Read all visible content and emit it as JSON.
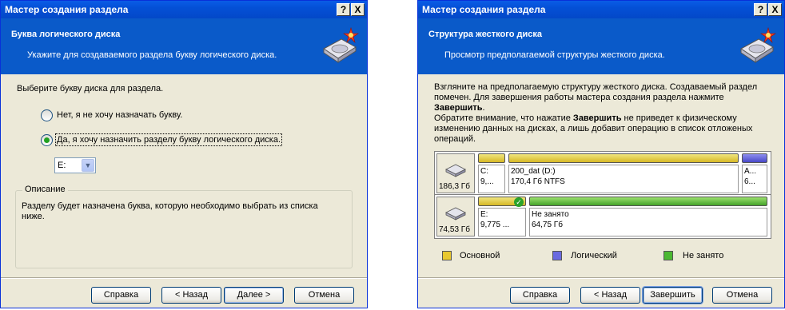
{
  "dialog_left": {
    "title": "Мастер создания раздела",
    "title_buttons": {
      "help": "?",
      "close": "X"
    },
    "header": {
      "title": "Буква логического диска",
      "subtitle": "Укажите для создаваемого раздела букву логического диска."
    },
    "prompt": "Выберите букву диска для раздела.",
    "options": [
      {
        "label": "Нет, я не хочу назначать букву.",
        "selected": false
      },
      {
        "label": "Да, я хочу назначить разделу букву логического диска.",
        "selected": true
      }
    ],
    "drive_letter": {
      "value": "E:"
    },
    "description": {
      "legend": "Описание",
      "text": "Разделу будет назначена буква, которую необходимо выбрать из списка ниже."
    },
    "buttons": {
      "help": "Справка",
      "back": "< Назад",
      "next": "Далее >",
      "cancel": "Отмена"
    }
  },
  "dialog_right": {
    "title": "Мастер создания раздела",
    "title_buttons": {
      "help": "?",
      "close": "X"
    },
    "header": {
      "title": "Структура жесткого диска",
      "subtitle": "Просмотр предполагаемой структуры жесткого диска."
    },
    "body": {
      "line1": "Взгляните на предполагаемую структуру жесткого диска. Создаваемый раздел",
      "line2": "помечен. Для завершения работы мастера создания раздела нажмите",
      "bold_finish": "Завершить",
      "period": ".",
      "line4_pre": "Обратите внимание, что нажатие ",
      "line4_bold": "Завершить",
      "line4_post": " не приведет к физическому",
      "line5": "изменению данных на дисках, а лишь добавит операцию в список отложеных",
      "line6": "операций."
    },
    "disks": [
      {
        "size": "186,3 Гб",
        "partitions": [
          {
            "name": "C:",
            "info": "9,...",
            "type": "primary"
          },
          {
            "name": "200_dat (D:)",
            "info": "170,4 Гб  NTFS",
            "type": "primary"
          },
          {
            "name": "A...",
            "info": "6...",
            "type": "logical"
          }
        ]
      },
      {
        "size": "74,53 Гб",
        "partitions": [
          {
            "name": "E:",
            "info": "9,775 ...",
            "type": "primary",
            "new": true,
            "check": "✓"
          },
          {
            "name": "Не занято",
            "info": "64,75 Гб",
            "type": "unallocated"
          }
        ]
      }
    ],
    "legend": [
      {
        "label": "Основной",
        "color": "#e8c830"
      },
      {
        "label": "Логический",
        "color": "#6a6ae0"
      },
      {
        "label": "Не занято",
        "color": "#4cb832"
      }
    ],
    "buttons": {
      "help": "Справка",
      "back": "< Назад",
      "finish": "Завершить",
      "cancel": "Отмена"
    }
  }
}
